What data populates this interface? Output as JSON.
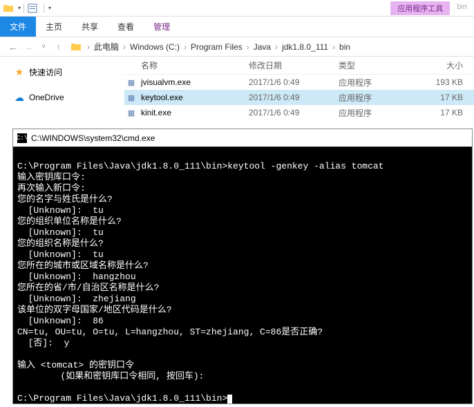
{
  "titlebar": {
    "context_active": "应用程序工具",
    "context_muted": "bin"
  },
  "ribbon": {
    "file": "文件",
    "home": "主页",
    "share": "共享",
    "view": "查看",
    "manage": "管理"
  },
  "nav": {
    "crumbs": [
      "此电脑",
      "Windows (C:)",
      "Program Files",
      "Java",
      "jdk1.8.0_111",
      "bin"
    ]
  },
  "sidebar": {
    "quick": "快速访问",
    "onedrive": "OneDrive"
  },
  "filelist": {
    "headers": {
      "name": "名称",
      "date": "修改日期",
      "type": "类型",
      "size": "大小"
    },
    "rows": [
      {
        "name": "jvisualvm.exe",
        "date": "2017/1/6 0:49",
        "type": "应用程序",
        "size": "193 KB",
        "sel": false
      },
      {
        "name": "keytool.exe",
        "date": "2017/1/6 0:49",
        "type": "应用程序",
        "size": "17 KB",
        "sel": true
      },
      {
        "name": "kinit.exe",
        "date": "2017/1/6 0:49",
        "type": "应用程序",
        "size": "17 KB",
        "sel": false
      }
    ]
  },
  "terminal": {
    "title": "C:\\WINDOWS\\system32\\cmd.exe",
    "lines": [
      "",
      "C:\\Program Files\\Java\\jdk1.8.0_111\\bin>keytool -genkey -alias tomcat",
      "输入密钥库口令:",
      "再次输入新口令:",
      "您的名字与姓氏是什么?",
      "  [Unknown]:  tu",
      "您的组织单位名称是什么?",
      "  [Unknown]:  tu",
      "您的组织名称是什么?",
      "  [Unknown]:  tu",
      "您所在的城市或区域名称是什么?",
      "  [Unknown]:  hangzhou",
      "您所在的省/市/自治区名称是什么?",
      "  [Unknown]:  zhejiang",
      "该单位的双字母国家/地区代码是什么?",
      "  [Unknown]:  86",
      "CN=tu, OU=tu, O=tu, L=hangzhou, ST=zhejiang, C=86是否正确?",
      "  [否]:  y",
      "",
      "输入 <tomcat> 的密钥口令",
      "        (如果和密钥库口令相同, 按回车):",
      "",
      "C:\\Program Files\\Java\\jdk1.8.0_111\\bin>"
    ]
  }
}
